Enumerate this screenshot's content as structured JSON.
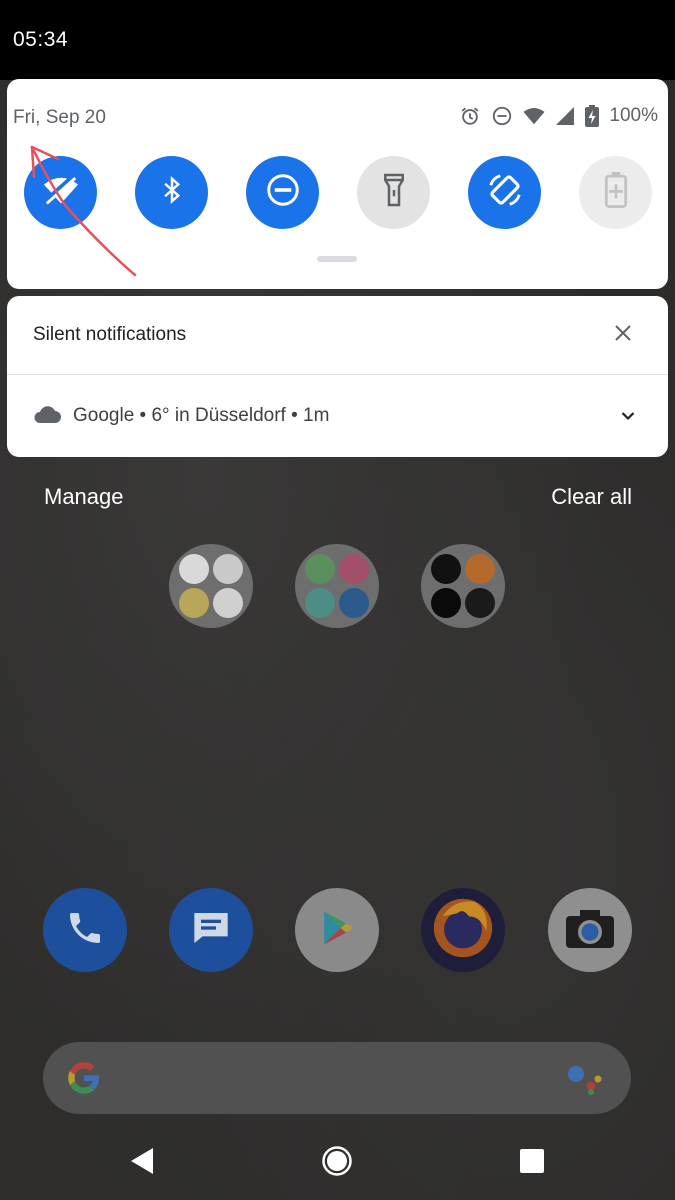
{
  "status_bar": {
    "time": "05:34",
    "battery": "100%"
  },
  "quick_settings": {
    "date": "Fri, Sep 20",
    "tiles": [
      {
        "name": "wifi",
        "state": "on",
        "icon": "wifi-icon"
      },
      {
        "name": "bluetooth",
        "state": "on",
        "icon": "bluetooth-icon"
      },
      {
        "name": "do-not-disturb",
        "state": "on",
        "icon": "do-not-disturb-icon"
      },
      {
        "name": "flashlight",
        "state": "off",
        "icon": "flashlight-icon"
      },
      {
        "name": "auto-rotate",
        "state": "on",
        "icon": "auto-rotate-icon"
      },
      {
        "name": "battery-saver",
        "state": "disabled",
        "icon": "battery-saver-icon"
      }
    ]
  },
  "notifications": {
    "section_title": "Silent notifications",
    "items": [
      {
        "app": "Google",
        "text": "Google • 6° in Düsseldorf • 1m",
        "icon": "cloud-icon"
      }
    ]
  },
  "actions": {
    "manage_label": "Manage",
    "clear_all_label": "Clear all"
  },
  "colors": {
    "accent": "#1a73e8",
    "tile_off": "#e3e3e3",
    "annotation": "#e8505b"
  }
}
